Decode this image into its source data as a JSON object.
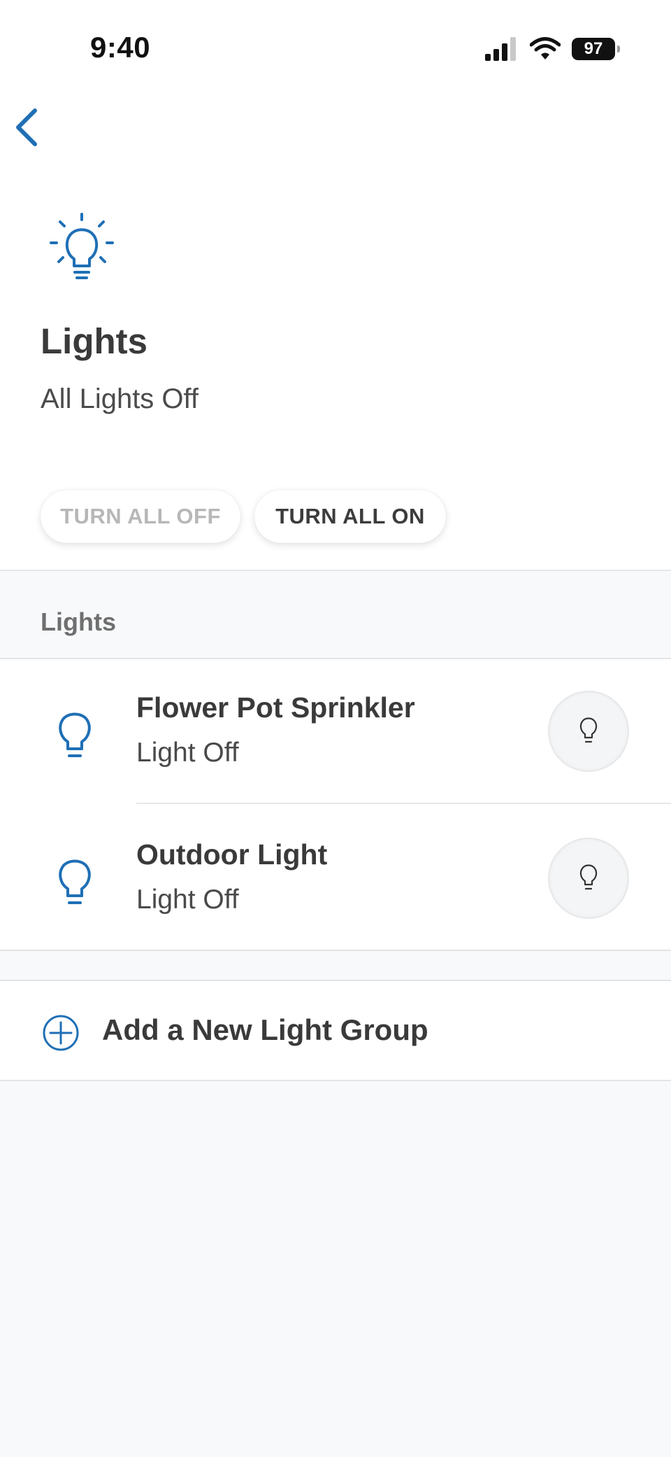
{
  "status_bar": {
    "time": "9:40",
    "battery": "97"
  },
  "header": {
    "title": "Lights",
    "subtitle": "All Lights Off"
  },
  "actions": {
    "turn_all_off": "TURN ALL OFF",
    "turn_all_on": "TURN ALL ON"
  },
  "section": {
    "title": "Lights"
  },
  "lights": [
    {
      "name": "Flower Pot Sprinkler",
      "status": "Light Off"
    },
    {
      "name": "Outdoor Light",
      "status": "Light Off"
    }
  ],
  "add_group": {
    "label": "Add a New Light Group"
  },
  "colors": {
    "accent": "#1f6fb5",
    "text": "#3a3a3a",
    "background": "#f8f9fb"
  }
}
